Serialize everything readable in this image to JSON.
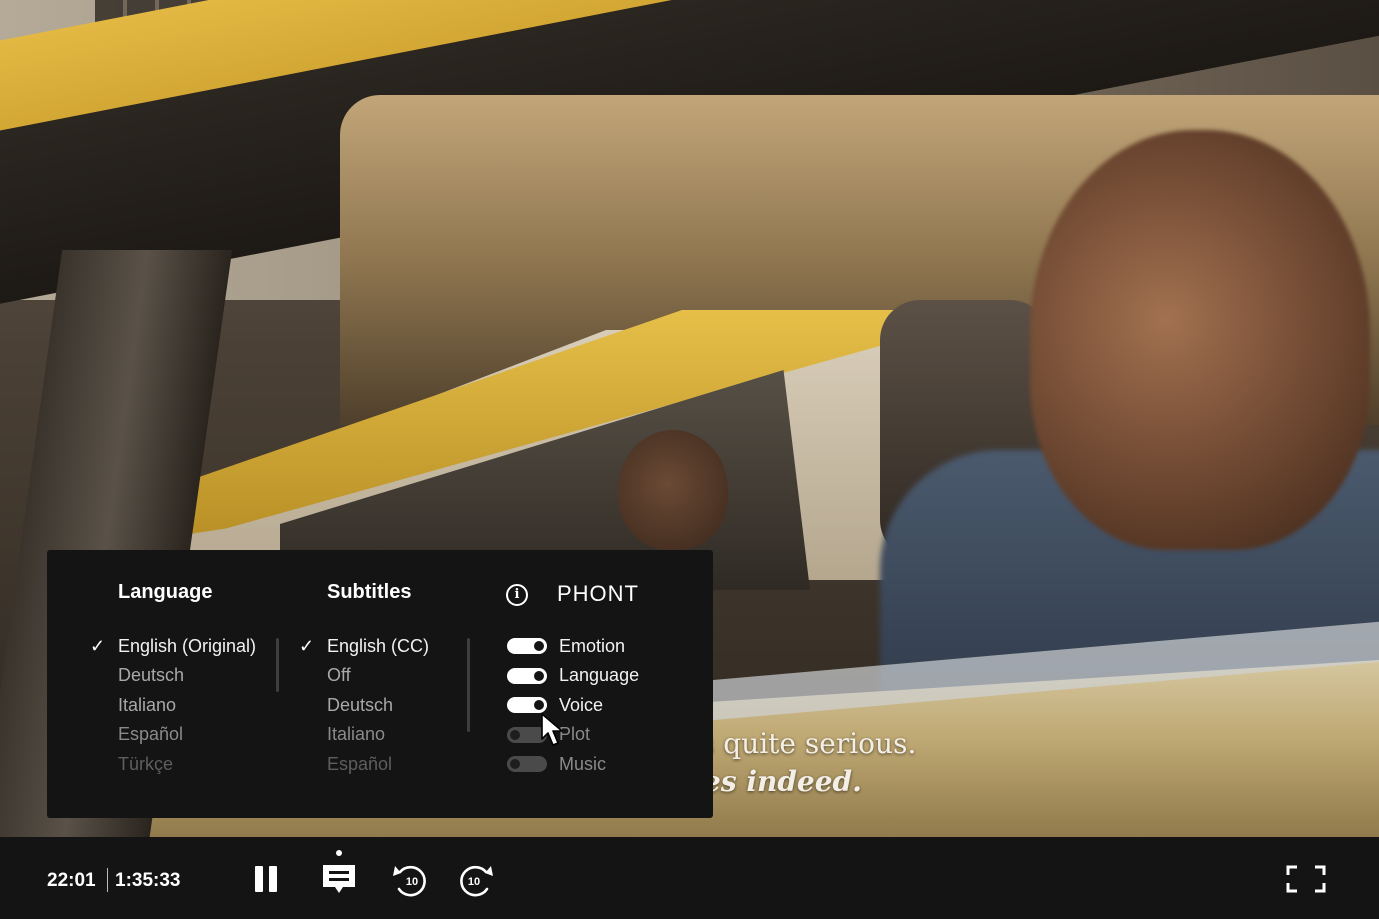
{
  "video": {
    "subtitle_line1": "s quite serious.",
    "subtitle_line2": "es indeed."
  },
  "settings_panel": {
    "language": {
      "title": "Language",
      "options": [
        {
          "label": "English (Original)",
          "selected": true
        },
        {
          "label": "Deutsch",
          "selected": false
        },
        {
          "label": "Italiano",
          "selected": false
        },
        {
          "label": "Español",
          "selected": false
        },
        {
          "label": "Türkçe",
          "selected": false
        }
      ]
    },
    "subtitles": {
      "title": "Subtitles",
      "options": [
        {
          "label": "English (CC)",
          "selected": true
        },
        {
          "label": "Off",
          "selected": false
        },
        {
          "label": "Deutsch",
          "selected": false
        },
        {
          "label": "Italiano",
          "selected": false
        },
        {
          "label": "Español",
          "selected": false
        }
      ]
    },
    "phont": {
      "brand": "PHONT",
      "info_icon": "info-icon",
      "toggles": [
        {
          "label": "Emotion",
          "on": true
        },
        {
          "label": "Language",
          "on": true
        },
        {
          "label": "Voice",
          "on": true
        },
        {
          "label": "Plot",
          "on": false
        },
        {
          "label": "Music",
          "on": false
        }
      ]
    }
  },
  "controls": {
    "current_time": "22:01",
    "total_time": "1:35:33",
    "icons": [
      "pause-icon",
      "subtitles-icon",
      "rewind-10-icon",
      "forward-10-icon",
      "fullscreen-icon"
    ],
    "skip_seconds": "10"
  },
  "colors": {
    "panel_bg": "#141414",
    "bar_bg": "#141414",
    "text": "#ffffff",
    "taxi_yellow": "#e2b843"
  }
}
